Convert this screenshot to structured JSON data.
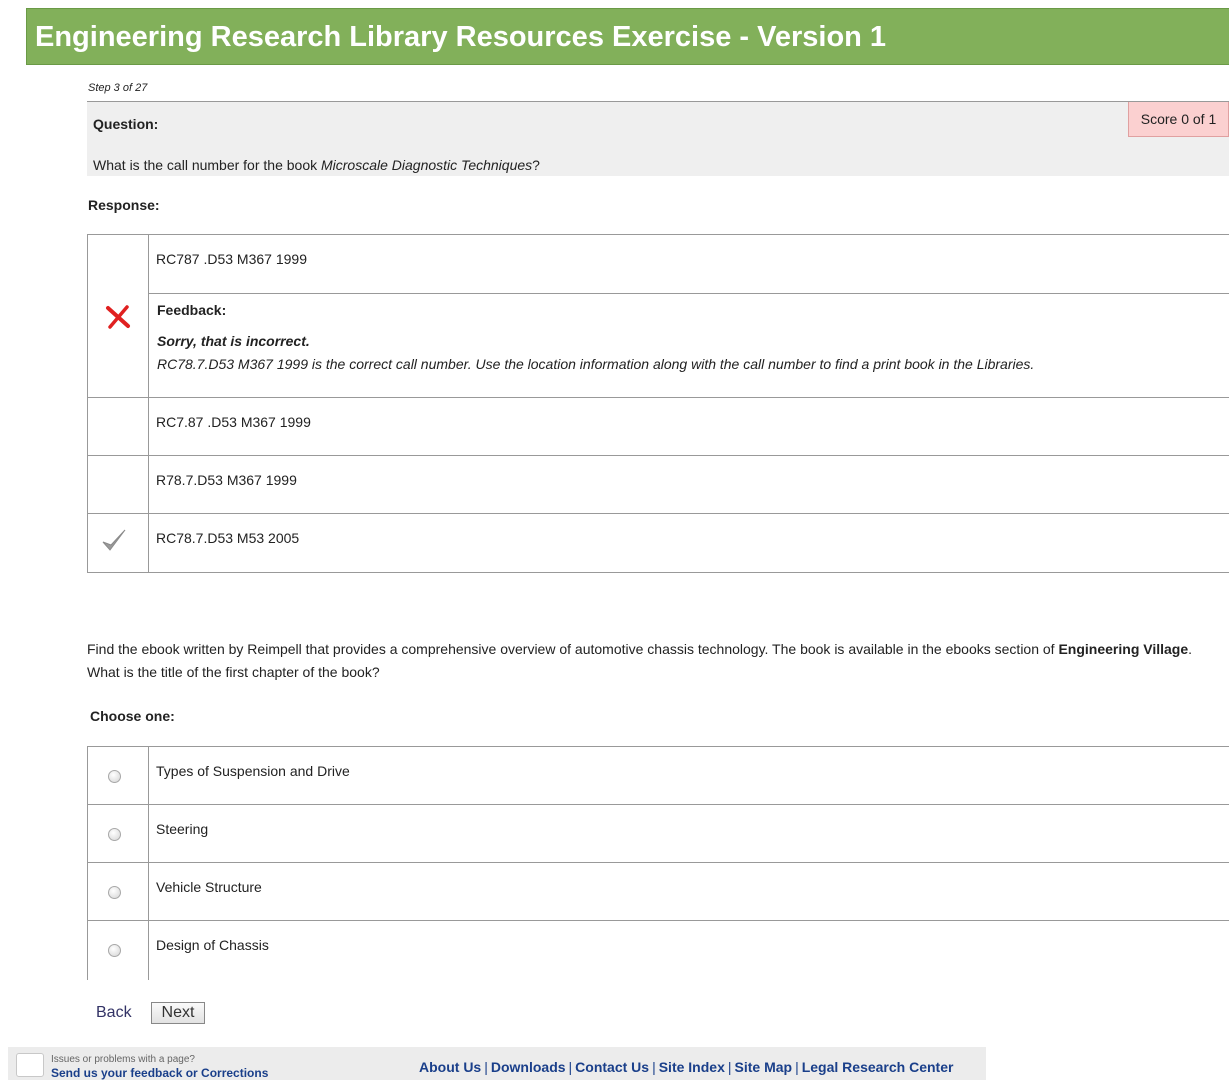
{
  "header": {
    "title": "Engineering Research Library Resources Exercise - Version 1"
  },
  "step": "Step 3 of 27",
  "question": {
    "label": "Question:",
    "text_before": "What is the call number for the book ",
    "book_title": "Microscale Diagnostic Techniques",
    "text_after": "?",
    "score": "Score 0 of 1"
  },
  "response": {
    "label": "Response:",
    "rows": [
      {
        "text": "RC787 .D53 M367 1999",
        "mark": "incorrect-x"
      },
      {
        "text": "RC7.87 .D53 M367 1999",
        "mark": ""
      },
      {
        "text": "R78.7.D53 M367 1999",
        "mark": ""
      },
      {
        "text": "RC78.7.D53 M53 2005",
        "mark": "checkmark"
      }
    ],
    "feedback": {
      "label": "Feedback:",
      "summary": "Sorry, that is incorrect.",
      "detail": "RC78.7.D53 M367 1999 is the correct call number. Use the location information along with the call number to find a print book in the Libraries."
    }
  },
  "question2": {
    "text_before": "Find the ebook written by Reimpell that provides a comprehensive overview of automotive chassis technology. The book is available in the ebooks section of ",
    "bold": "Engineering Village",
    "text_after": ". What is the title of the first chapter of the book?",
    "choose_label": "Choose one:",
    "options": [
      "Types of Suspension and Drive",
      "Steering",
      "Vehicle Structure",
      "Design of Chassis"
    ]
  },
  "nav": {
    "back": "Back",
    "next": "Next"
  },
  "footer": {
    "issues": "Issues or problems with a page?",
    "send_feedback": "Send us your feedback or Corrections",
    "links": [
      "About Us",
      "Downloads",
      "Contact Us",
      "Site Index",
      "Site Map",
      "Legal Research Center"
    ]
  },
  "colors": {
    "banner": "#82b05a",
    "score_bg": "#fbd0d0",
    "incorrect": "#e02020",
    "link": "#1a3f8a"
  }
}
